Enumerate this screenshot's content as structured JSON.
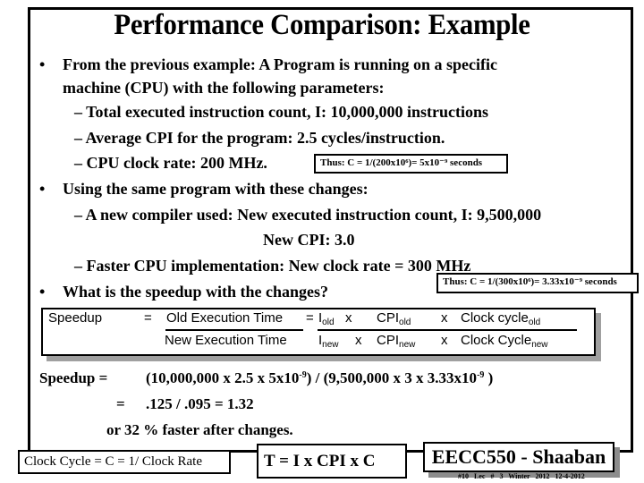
{
  "slide": {
    "title": "Performance Comparison: Example",
    "bullets": [
      {
        "lines": [
          "From the previous example:  A Program is running on a specific",
          "machine (CPU) with the following parameters:"
        ],
        "sub_items": [
          "– Total executed instruction count, I:     10,000,000 instructions",
          "– Average CPI for the program:  2.5  cycles/instruction.",
          "– CPU clock rate:  200 MHz."
        ]
      },
      {
        "lines": [
          "Using the same program with these changes:"
        ],
        "sub_items": [
          "– A new compiler used:  New executed instruction count, I:  9,500,000",
          "New CPI:  3.0",
          "– Faster CPU implementation:  New clock rate = 300 MHz"
        ]
      },
      {
        "lines": [
          "What is the speedup with the changes?"
        ]
      }
    ],
    "bullet_glyph": "•",
    "notes": {
      "old_clock": "Thus: C = 1/(200x10⁶)= 5x10⁻⁹ seconds",
      "new_clock": "Thus: C = 1/(300x10⁶)= 3.33x10⁻⁹ seconds"
    },
    "formula": {
      "label": "Speedup",
      "eq1": "=",
      "numerator": "Old Execution Time",
      "denominator": "New Execution Time",
      "eq2": "=",
      "i_base": "I",
      "old_sub": "old",
      "new_sub": "new",
      "times": "x",
      "cpi_base": "CPI",
      "clock_old": "Clock cycle",
      "clock_new": "Clock Cycle"
    },
    "calculation": {
      "label": "Speedup  =",
      "line1": "(10,000,000  x   2.5  x  5x10",
      "exp1": "-9",
      "line1b": ") / (9,500,000  x 3  x  3.33x10",
      "exp2": "-9",
      "line1c": " )",
      "eq": "=",
      "line2": ".125 /  .095 = 1.32",
      "line3": "or 32 % faster after changes."
    },
    "bottom": {
      "clock_cycle": "Clock Cycle = C = 1/ Clock Rate",
      "time_formula": "T =  I  x  CPI   x C",
      "brand": "EECC550 - Shaaban",
      "footer": "#10  Lec # 3  Winter 2012  12-4-2012"
    }
  }
}
